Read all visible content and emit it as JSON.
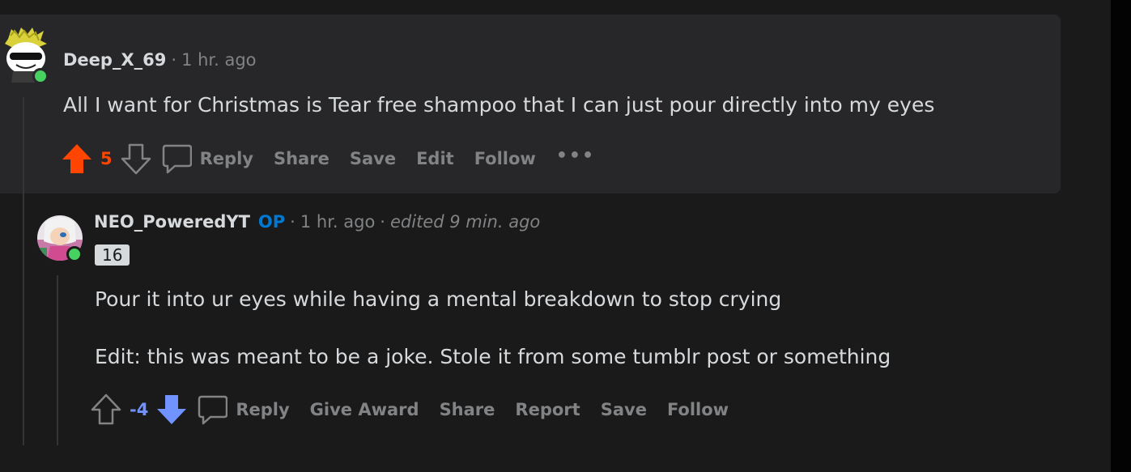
{
  "comments": [
    {
      "username": "Deep_X_69",
      "time": "1 hr. ago",
      "body": [
        "All I want for Christmas is Tear free shampoo that I can just pour directly into my eyes"
      ],
      "score": "5",
      "vote": "upvoted",
      "actions": [
        "Reply",
        "Share",
        "Save",
        "Edit",
        "Follow"
      ],
      "more": "•••"
    },
    {
      "username": "NEO_PoweredYT",
      "op_badge": "OP",
      "time": "1 hr. ago",
      "edited": "edited 9 min. ago",
      "flair": "16",
      "body": [
        "Pour it into ur eyes while having a mental breakdown to stop crying",
        "Edit: this was meant to be a joke. Stole it from some tumblr post or something"
      ],
      "score": "-4",
      "vote": "downvoted",
      "actions": [
        "Reply",
        "Give Award",
        "Share",
        "Report",
        "Save",
        "Follow"
      ]
    }
  ],
  "separator": "·",
  "colors": {
    "upvote": "#ff4500",
    "downvote": "#7193ff",
    "op": "#0079d3",
    "online": "#46d160"
  }
}
